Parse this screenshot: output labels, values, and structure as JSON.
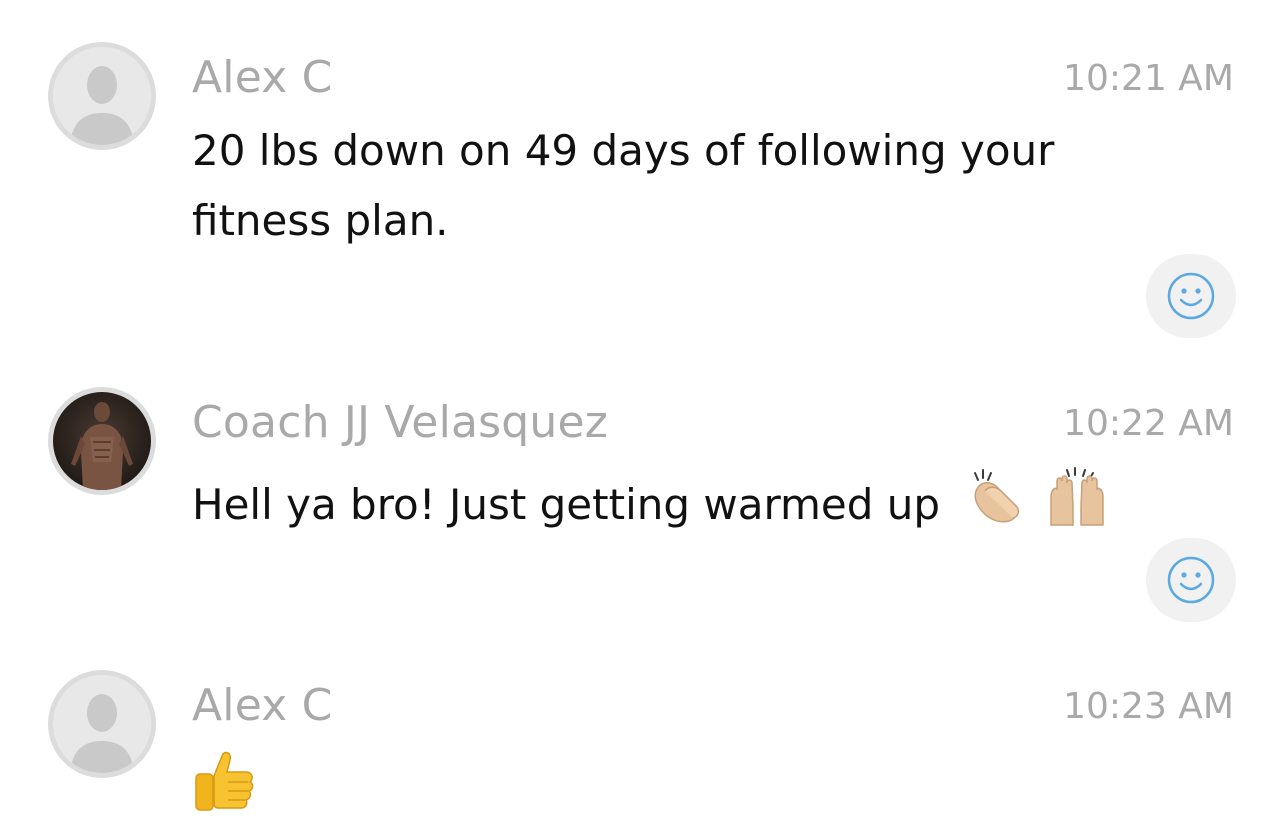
{
  "messages": [
    {
      "author": "Alex C",
      "time": "10:21 AM",
      "text": "20 lbs down on 49 days of following your fitness plan.",
      "avatar_icon": "default-user-silhouette-icon",
      "has_reaction_button": true
    },
    {
      "author": "Coach JJ Velasquez",
      "time": "10:22 AM",
      "text": "Hell ya bro! Just getting warmed up",
      "avatar_icon": "coach-photo-avatar",
      "emoji_icons": [
        "clapping-hands-icon",
        "raising-hands-icon"
      ],
      "has_reaction_button": true
    },
    {
      "author": "Alex C",
      "time": "10:23 AM",
      "text": "",
      "avatar_icon": "default-user-silhouette-icon",
      "emoji_icons": [
        "thumbs-up-icon"
      ]
    }
  ],
  "reaction_icon": "smiley-face-icon",
  "colors": {
    "meta_text": "#a9a9a9",
    "body_text": "#111111",
    "reaction_bg": "#f1f1f1",
    "reaction_icon": "#5aa9e0",
    "avatar_border": "#dcdcdc"
  }
}
